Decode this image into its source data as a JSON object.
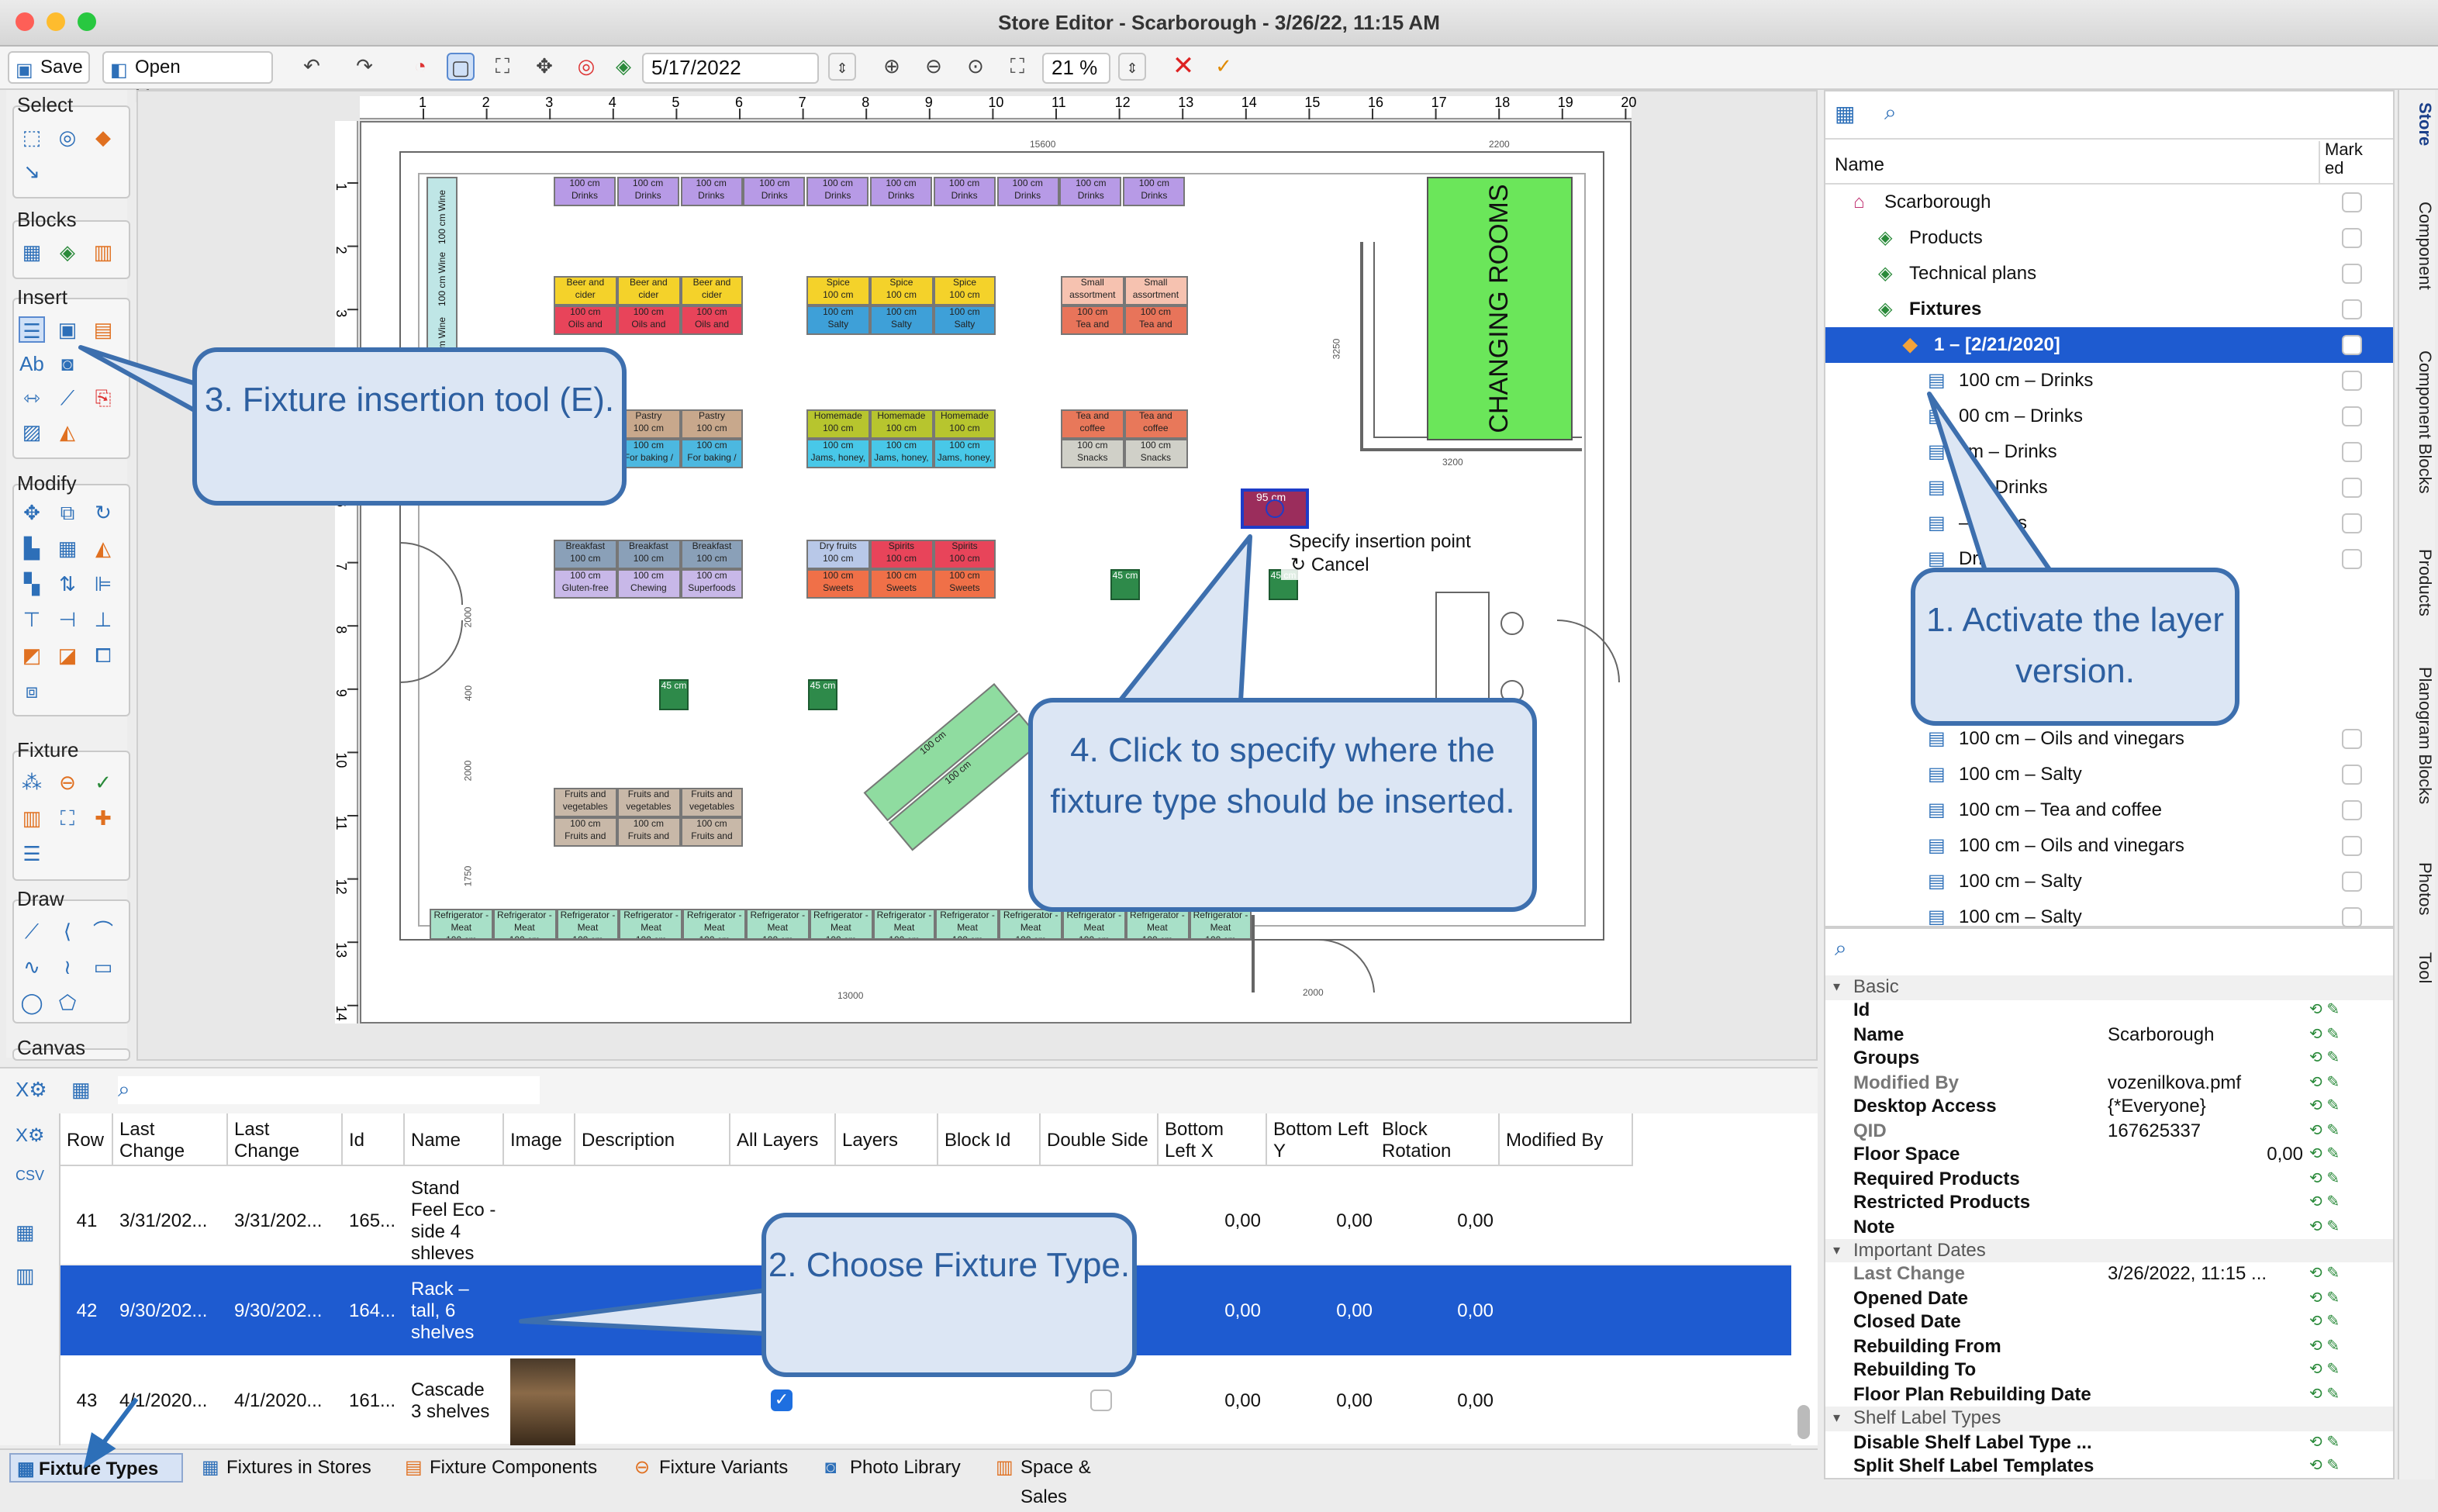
{
  "window": {
    "title": "Store Editor - Scarborough - 3/26/22, 11:15 AM"
  },
  "toolbar": {
    "save": "Save",
    "open_messages": "Open Messages",
    "date": "5/17/2022",
    "zoom": "21 %"
  },
  "palette": {
    "select": "Select",
    "blocks": "Blocks",
    "insert": "Insert",
    "modify": "Modify",
    "fixture": "Fixture",
    "draw": "Draw",
    "canvas": "Canvas"
  },
  "plan": {
    "top_ticks": [
      "1",
      "2",
      "3",
      "4",
      "5",
      "6",
      "7",
      "8",
      "9",
      "10",
      "11",
      "12",
      "13",
      "14",
      "15",
      "16",
      "17",
      "18",
      "19",
      "20"
    ],
    "left_ticks": [
      "1",
      "2",
      "3",
      "4",
      "5",
      "6",
      "7",
      "8",
      "9",
      "10",
      "11",
      "12",
      "13",
      "14"
    ],
    "dims": {
      "d15600": "15600",
      "d2200": "2200",
      "d3250": "3250",
      "d3200": "3200",
      "d2000a": "2000",
      "d400": "400",
      "d2000b": "2000",
      "d1750": "1750",
      "d13000": "13000",
      "d2000c": "2000"
    },
    "changing_rooms": "CHANGING ROOMS",
    "wine": "100 cm Wine",
    "drink_top": "100 cm",
    "drink_bot": "Drinks",
    "cm100": "100 cm",
    "cm45": "45 cm",
    "cm95": "95 cm",
    "labels": {
      "beer": "Beer and cider",
      "oils": "Oils and vinegars",
      "spice": "Spice",
      "salty": "Salty",
      "small": "Small assortment",
      "tea": "Tea and coffee",
      "pastry": "Pastry",
      "forbaking": "For baking / cooking",
      "homemade": "Homemade",
      "jams": "Jams, honey, sweet creams",
      "snacks": "Snacks",
      "breakfast": "Breakfast",
      "gluten": "Gluten-free and diet",
      "chewing": "Chewing gums",
      "superfoods": "Superfoods",
      "dryfruits": "Dry fruits",
      "spirits": "Spirits",
      "sweets": "Sweets",
      "fruits": "Fruits and vegetables",
      "fridge": "Refrigerator - Meat"
    },
    "popup": {
      "line1": "Specify insertion point",
      "line2": "Cancel"
    }
  },
  "callouts": {
    "c1": "1. Activate the layer version.",
    "c2": "2. Choose Fixture Type.",
    "c3": "3. Fixture insertion tool (E).",
    "c4": "4. Click to specify where the fixture type should be inserted."
  },
  "tree": {
    "header_name": "Name",
    "header_marked": "Mark ed",
    "items": [
      {
        "label": "Scarborough"
      },
      {
        "label": "Products"
      },
      {
        "label": "Technical plans"
      },
      {
        "label": "Fixtures"
      },
      {
        "label": "1 – [2/21/2020]"
      },
      {
        "label": "100 cm – Drinks"
      },
      {
        "label": "00 cm – Drinks"
      },
      {
        "label": "cm – Drinks"
      },
      {
        "label": "m – Drinks"
      },
      {
        "label": "– Drinks"
      },
      {
        "label": "Drinks"
      },
      {
        "label": "100 cm – Oils and vinegars"
      },
      {
        "label": "100 cm – Salty"
      },
      {
        "label": "100 cm – Tea and coffee"
      },
      {
        "label": "100 cm – Oils and vinegars"
      },
      {
        "label": "100 cm – Salty"
      },
      {
        "label": "100 cm – Salty"
      }
    ]
  },
  "props": {
    "rows": [
      {
        "k": "Basic",
        "v": ""
      },
      {
        "k": "Id",
        "v": ""
      },
      {
        "k": "Name",
        "v": "Scarborough"
      },
      {
        "k": "Groups",
        "v": ""
      },
      {
        "k": "Modified By",
        "v": "vozenilkova.pmf"
      },
      {
        "k": "Desktop Access",
        "v": "{*Everyone}"
      },
      {
        "k": "QID",
        "v": "167625337"
      },
      {
        "k": "Floor Space",
        "v": "0,00"
      },
      {
        "k": "Required Products",
        "v": ""
      },
      {
        "k": "Restricted Products",
        "v": ""
      },
      {
        "k": "Note",
        "v": ""
      },
      {
        "k": "Important Dates",
        "v": ""
      },
      {
        "k": "Last Change",
        "v": "3/26/2022, 11:15 ..."
      },
      {
        "k": "Opened Date",
        "v": ""
      },
      {
        "k": "Closed Date",
        "v": ""
      },
      {
        "k": "Rebuilding From",
        "v": ""
      },
      {
        "k": "Rebuilding To",
        "v": ""
      },
      {
        "k": "Floor Plan Rebuilding Date",
        "v": ""
      },
      {
        "k": "Shelf Label Types",
        "v": ""
      },
      {
        "k": "Disable Shelf Label Type ...",
        "v": ""
      },
      {
        "k": "Split Shelf Label Templates",
        "v": ""
      }
    ]
  },
  "side_tabs": [
    "Store",
    "Component",
    "Component Blocks",
    "Products",
    "Planogram Blocks",
    "Photos",
    "Tool"
  ],
  "table": {
    "headers": [
      "Row",
      "Last Change",
      "Last Change",
      "Id",
      "Name",
      "Image",
      "Description",
      "All Layers",
      "Layers",
      "Block Id",
      "Double Side",
      "Bottom Left X",
      "Bottom Left Y",
      "Block Rotation",
      "Modified By"
    ],
    "rows": [
      {
        "row": "41",
        "lc1": "3/31/202...",
        "lc2": "3/31/202...",
        "id": "165...",
        "name": "Stand Feel Eco -side 4 shleves",
        "blx": "0,00",
        "bly": "0,00",
        "rot": "0,00"
      },
      {
        "row": "42",
        "lc1": "9/30/202...",
        "lc2": "9/30/202...",
        "id": "164...",
        "name": "Rack – tall, 6 shelves",
        "blx": "0,00",
        "bly": "0,00",
        "rot": "0,00"
      },
      {
        "row": "43",
        "lc1": "4/1/2020...",
        "lc2": "4/1/2020...",
        "id": "161...",
        "name": "Cascade 3 shelves",
        "blx": "0,00",
        "bly": "0,00",
        "rot": "0,00"
      }
    ]
  },
  "bottom_tabs": [
    "Fixture Types",
    "Fixtures in Stores",
    "Fixture Components",
    "Fixture Variants",
    "Photo Library",
    "Space & Sales"
  ],
  "colors": {
    "accent": "#1a5ad6",
    "callout_border": "#3d6fae",
    "callout_fill": "#dce6f4"
  }
}
